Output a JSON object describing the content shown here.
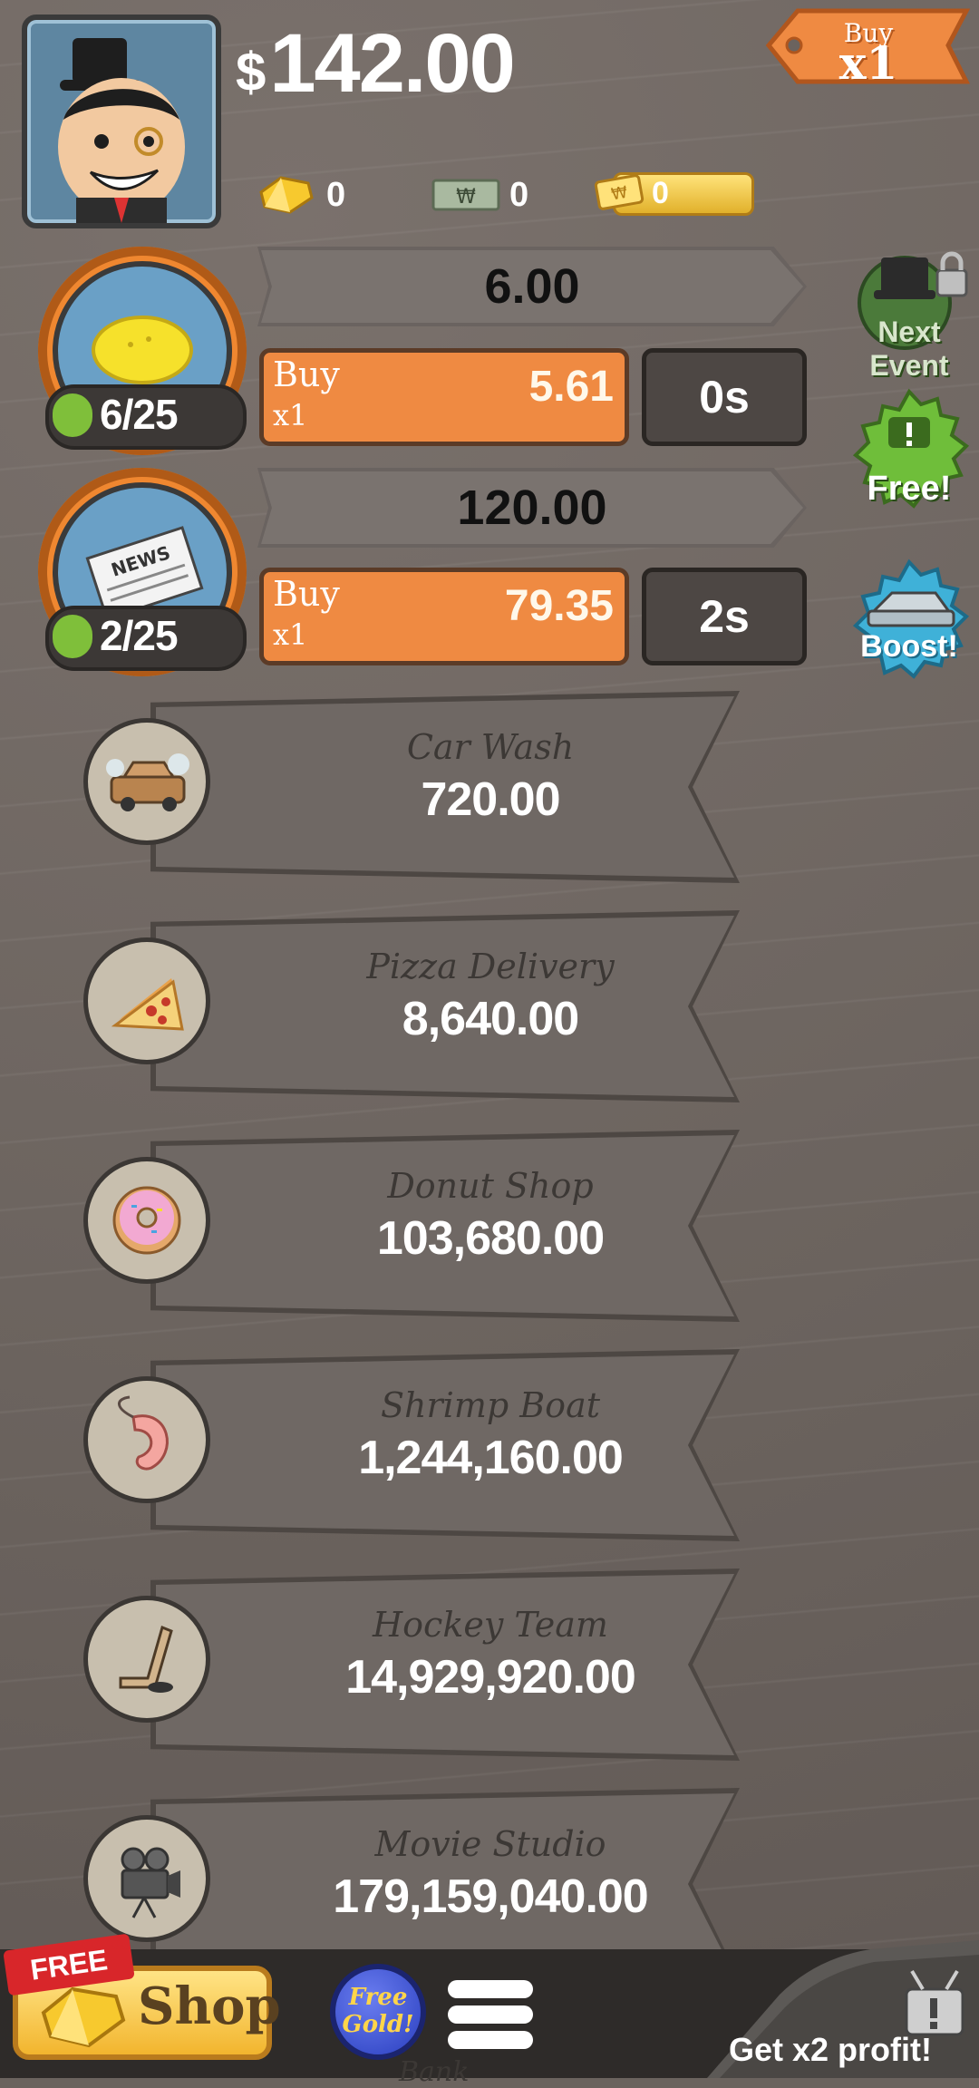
{
  "hud": {
    "money_symbol": "$",
    "money_value": "142.00",
    "buy_multiplier": {
      "top": "Buy",
      "bottom": "x1"
    },
    "gold_count": "0",
    "megabucks_count": "0",
    "ticket_count": "0"
  },
  "businesses": [
    {
      "name": "Lemonade Stand",
      "icon": "lemon-icon",
      "revenue": "6.00",
      "progress": "6/25",
      "buy_label": "Buy",
      "buy_qty": "x1",
      "buy_cost": "5.61",
      "timer": "0s"
    },
    {
      "name": "Newspaper",
      "icon": "newspaper-icon",
      "revenue": "120.00",
      "progress": "2/25",
      "buy_label": "Buy",
      "buy_qty": "x1",
      "buy_cost": "79.35",
      "timer": "2s"
    }
  ],
  "locked": [
    {
      "name": "Car Wash",
      "price": "720.00",
      "icon": "car-icon"
    },
    {
      "name": "Pizza Delivery",
      "price": "8,640.00",
      "icon": "pizza-icon"
    },
    {
      "name": "Donut Shop",
      "price": "103,680.00",
      "icon": "donut-icon"
    },
    {
      "name": "Shrimp Boat",
      "price": "1,244,160.00",
      "icon": "shrimp-icon"
    },
    {
      "name": "Hockey Team",
      "price": "14,929,920.00",
      "icon": "hockey-icon"
    },
    {
      "name": "Movie Studio",
      "price": "179,159,040.00",
      "icon": "camera-icon"
    }
  ],
  "sidebar": {
    "next_event": "Next Event",
    "free": "Free!",
    "boost": "Boost!"
  },
  "bottom": {
    "free_flag": "FREE",
    "shop": "Shop",
    "free_gold": "Free Gold!",
    "x2_profit": "Get x2 profit!",
    "peek_label": "Bank"
  },
  "colors": {
    "accent_orange": "#ef8a42",
    "progress_green": "#7fbf3a",
    "background": "#6b635e"
  }
}
